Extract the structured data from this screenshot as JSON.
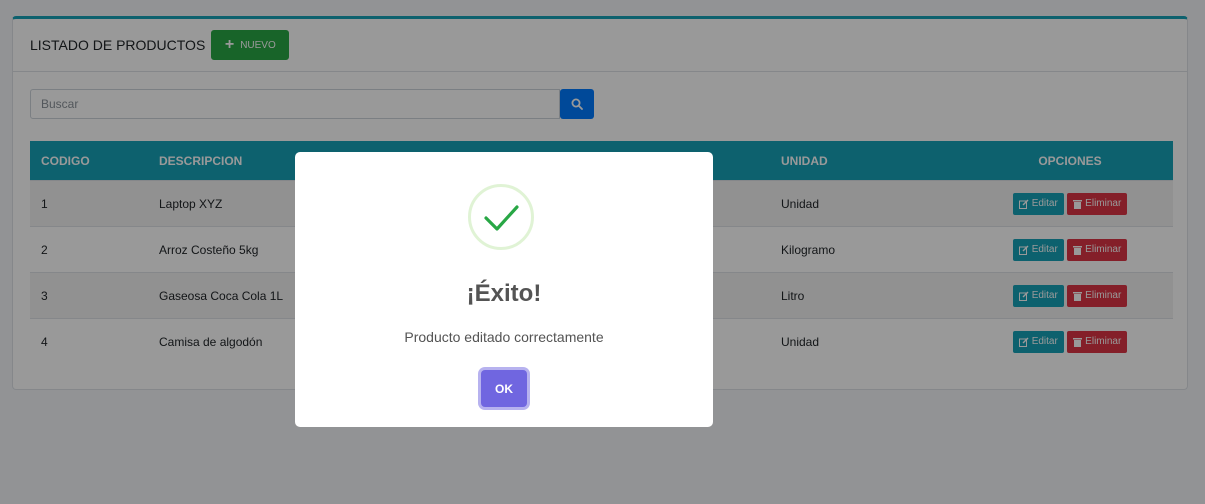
{
  "header": {
    "title": "LISTADO DE PRODUCTOS",
    "new_button_label": "NUEVO",
    "new_button_icon": "plus-icon"
  },
  "search": {
    "placeholder": "Buscar",
    "value": "",
    "button_icon": "search-icon"
  },
  "table": {
    "columns": [
      "CODIGO",
      "DESCRIPCION",
      "UNIDAD",
      "OPCIONES"
    ],
    "rows": [
      {
        "codigo": "1",
        "descripcion": "Laptop XYZ",
        "unidad": "Unidad"
      },
      {
        "codigo": "2",
        "descripcion": "Arroz Costeño 5kg",
        "unidad": "Kilogramo"
      },
      {
        "codigo": "3",
        "descripcion": "Gaseosa Coca Cola 1L",
        "unidad": "Litro"
      },
      {
        "codigo": "4",
        "descripcion": "Camisa de algodón",
        "unidad": "Unidad"
      }
    ],
    "edit_label": "Editar",
    "delete_label": "Eliminar",
    "edit_icon": "edit-icon",
    "delete_icon": "trash-icon"
  },
  "modal": {
    "icon": "success-check-icon",
    "title": "¡Éxito!",
    "message": "Producto editado correctamente",
    "ok_label": "OK"
  },
  "colors": {
    "header_accent": "#17a2b8",
    "new_button": "#28a745",
    "search_button": "#007bff",
    "edit_button": "#17a2b8",
    "delete_button": "#dc3545",
    "ok_button": "#7066e0",
    "success_check": "#a5dc86"
  }
}
